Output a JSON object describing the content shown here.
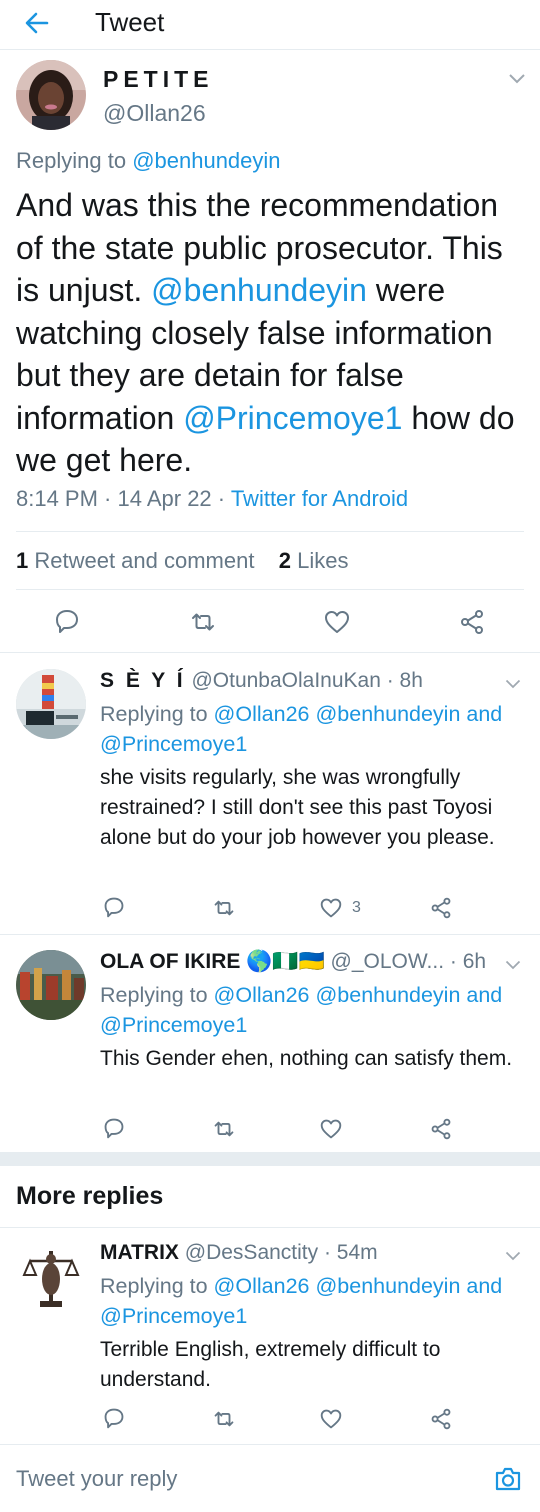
{
  "header": {
    "title": "Tweet",
    "back_icon": "arrow-left-icon",
    "accent": "#1b95e0"
  },
  "tweet": {
    "name": "PETITE",
    "handle": "@Ollan26",
    "replying_prefix": "Replying to ",
    "replying_to": "@benhundeyin",
    "text_parts": [
      "And was this the recommendation of the state public prosecutor. This is unjust. ",
      "@benhundeyin",
      " were watching closely false information but they are detain for false information ",
      "@Princemoye1",
      " how do we get here."
    ],
    "time": "8:14 PM · 14 Apr 22 · ",
    "source": "Twitter for Android",
    "retweet_count": "1",
    "retweet_label": " Retweet and comment",
    "like_count": "2",
    "like_label": " Likes"
  },
  "replies": [
    {
      "name": "S È Y Í",
      "handle": "@OtunbaOlaInuKan · 8h",
      "replying_prefix": "Replying to ",
      "replying_to": "@Ollan26 @benhundeyin and @Princemoye1",
      "text": "she visits regularly, she was wrongfully restrained? I still don't see this past Toyosi alone but do your job however you please.",
      "like_count": "3"
    },
    {
      "name": "OLA OF IKIRE",
      "name_emoji": "🌎🇳🇬🇺🇦",
      "handle": " @_OLOW... · 6h",
      "replying_prefix": "Replying to ",
      "replying_to": "@Ollan26 @benhundeyin and @Princemoye1",
      "text": "This Gender ehen, nothing can satisfy them.",
      "like_count": ""
    }
  ],
  "more_replies": {
    "title": "More replies",
    "reply": {
      "name": "MATRIX",
      "handle": " @DesSanctity · 54m",
      "replying_prefix": "Replying to ",
      "replying_to": "@Ollan26 @benhundeyin and @Princemoye1",
      "text": "Terrible English, extremely difficult to understand."
    }
  },
  "composer": {
    "placeholder": "Tweet your reply",
    "camera_icon": "camera-icon"
  }
}
